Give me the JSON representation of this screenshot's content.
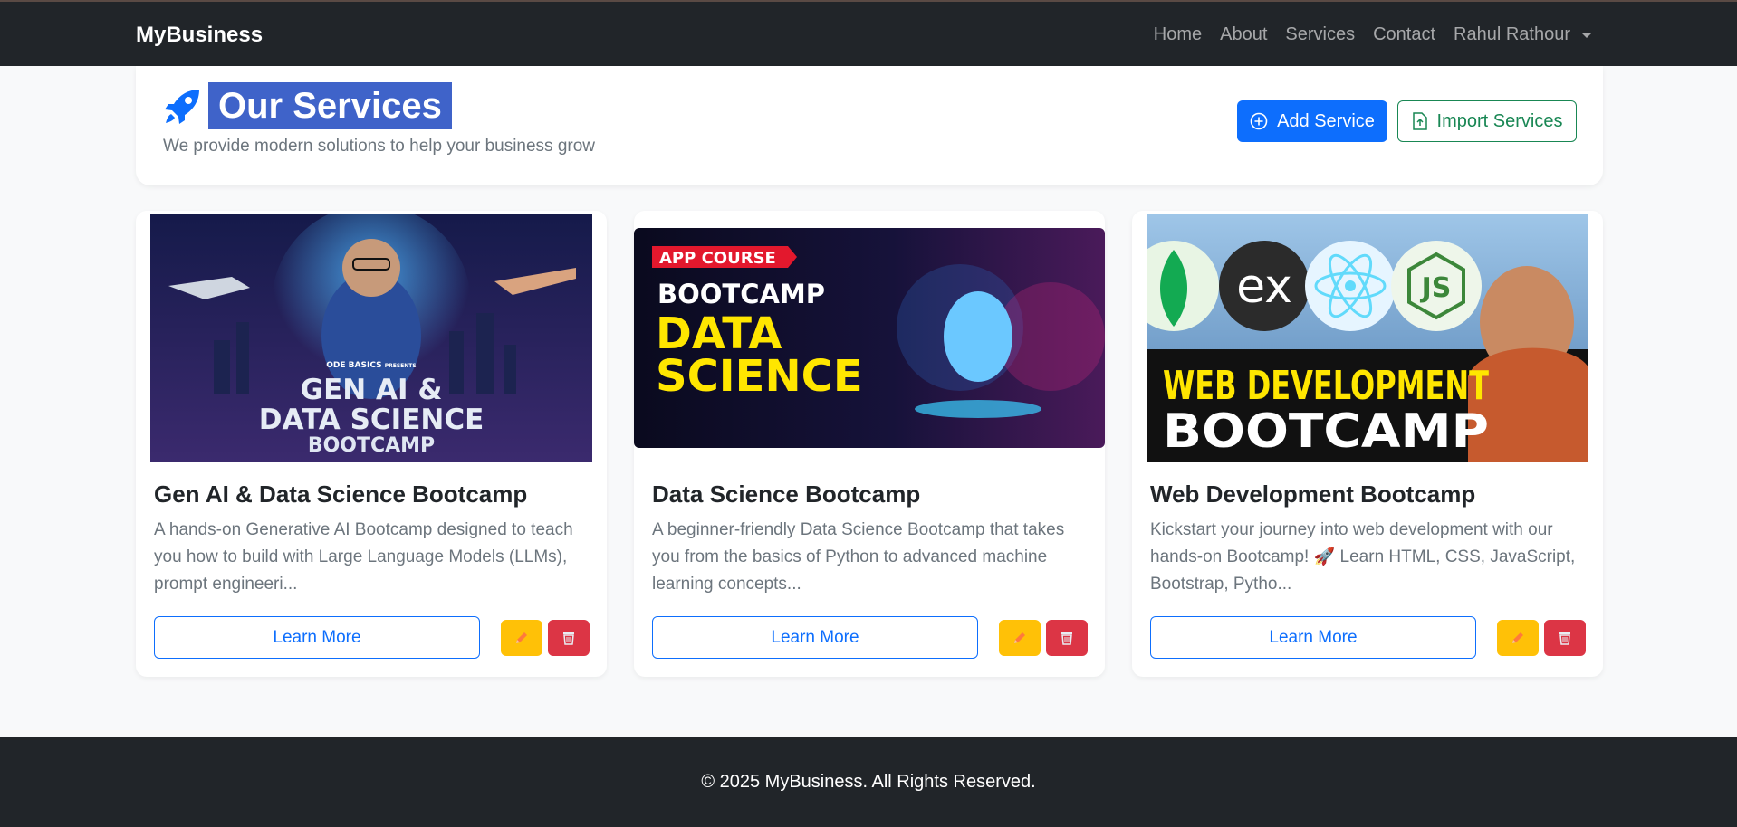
{
  "navbar": {
    "brand": "MyBusiness",
    "links": [
      "Home",
      "About",
      "Services",
      "Contact"
    ],
    "user": "Rahul Rathour"
  },
  "header": {
    "title": "Our Services",
    "subtitle": "We provide modern solutions to help your business grow",
    "add_label": "Add Service",
    "import_label": "Import Services"
  },
  "cards": [
    {
      "title": "Gen AI & Data Science Bootcamp",
      "description": "A hands-on Generative AI Bootcamp designed to teach you how to build with Large Language Models (LLMs), prompt engineeri...",
      "learn_label": "Learn More",
      "image_text": {
        "brand": "ODE BASICS",
        "presents": "PRESENTS",
        "line1": "GEN AI &",
        "line2": "DATA SCIENCE",
        "line3": "BOOTCAMP"
      }
    },
    {
      "title": "Data Science Bootcamp",
      "description": "A beginner-friendly Data Science Bootcamp that takes you from the basics of Python to advanced machine learning concepts...",
      "learn_label": "Learn More",
      "image_text": {
        "badge": "APP COURSE",
        "line1": "BOOTCAMP",
        "line2": "DATA",
        "line3": "SCIENCE"
      }
    },
    {
      "title": "Web Development Bootcamp",
      "description": "Kickstart your journey into web development with our hands-on Bootcamp! 🚀 Learn HTML, CSS, JavaScript, Bootstrap, Pytho...",
      "learn_label": "Learn More",
      "image_text": {
        "ex": "ex",
        "js": "JS",
        "line1": "WEB DEVELOPMENT",
        "line2": "BOOTCAMP"
      }
    }
  ],
  "footer": {
    "text": "© 2025 MyBusiness. All Rights Reserved."
  },
  "colors": {
    "navbar": "#212529",
    "primary": "#0d6efd",
    "success": "#198754",
    "warning": "#ffc107",
    "danger": "#dc3545",
    "title_highlight": "#3f63c9"
  },
  "icons": {
    "rocket": "rocket-icon",
    "add": "plus-circle-icon",
    "import": "file-upload-icon",
    "edit": "pencil-icon",
    "delete": "trash-icon"
  }
}
